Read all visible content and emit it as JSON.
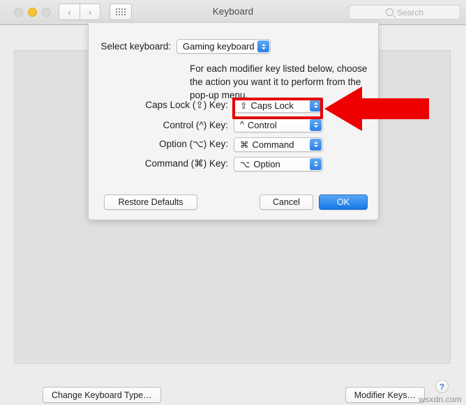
{
  "window": {
    "title": "Keyboard",
    "traffic_lights": [
      "close",
      "minimize",
      "zoom"
    ],
    "nav": {
      "back": "‹",
      "forward": "›"
    },
    "show_all_icon": "grid-icon",
    "search": {
      "placeholder": "Search",
      "value": "",
      "icon": "search-icon"
    }
  },
  "pane": {
    "change_keyboard_type_button": "Change Keyboard Type…",
    "modifier_keys_button": "Modifier Keys…",
    "help_button": "?"
  },
  "sheet": {
    "select_keyboard_label": "Select keyboard:",
    "selected_keyboard": "Gaming keyboard",
    "instructions": "For each modifier key listed below, choose the action you want it to perform from the pop-up menu.",
    "modifier_rows": [
      {
        "label": "Caps Lock (⇪) Key:",
        "glyph": "⇪",
        "value": "Caps Lock"
      },
      {
        "label": "Control (^) Key:",
        "glyph": "^",
        "value": "Control"
      },
      {
        "label": "Option (⌥) Key:",
        "glyph": "⌘",
        "value": "Command"
      },
      {
        "label": "Command (⌘) Key:",
        "glyph": "⌥",
        "value": "Option"
      }
    ],
    "buttons": {
      "restore_defaults": "Restore Defaults",
      "cancel": "Cancel",
      "ok": "OK"
    }
  },
  "annotation": {
    "highlight_color": "#e60000",
    "arrow_color": "#ee0000",
    "arrow_direction": "left",
    "target": "caps-lock-popup"
  },
  "watermark": "wsxdn.com"
}
